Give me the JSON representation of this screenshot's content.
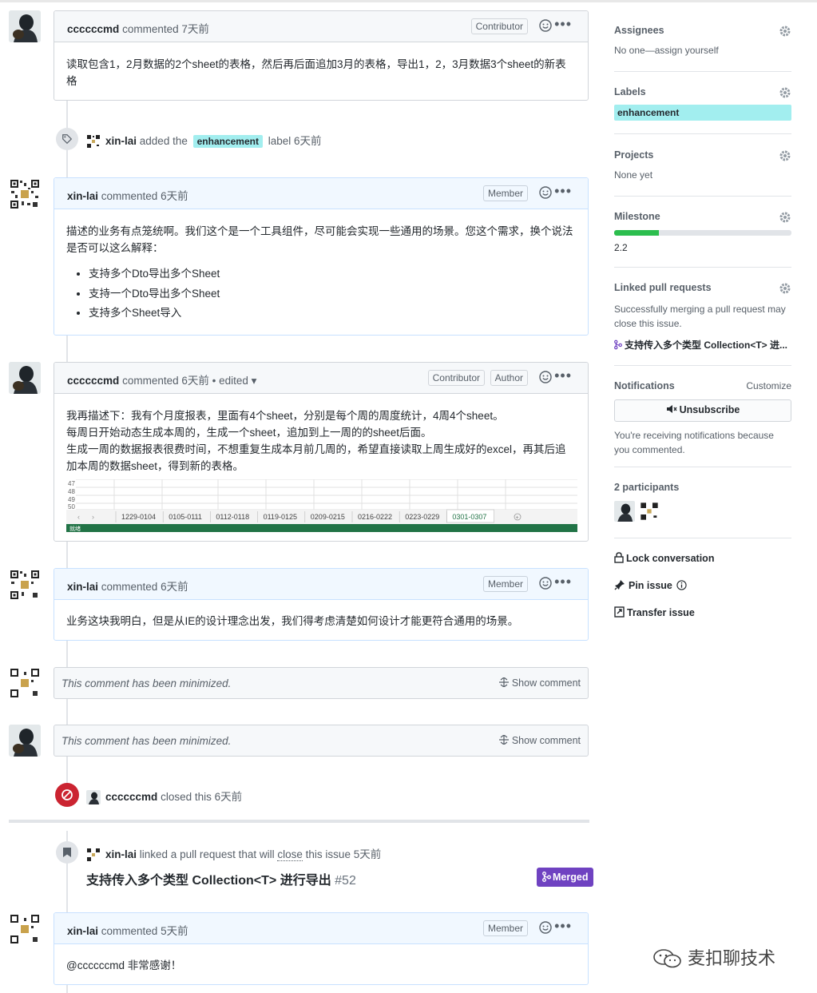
{
  "comments": [
    {
      "author": "ccccccmd",
      "action": "commented",
      "time": "7天前",
      "badges": [
        "Contributor"
      ],
      "body": "读取包含1，2月数据的2个sheet的表格，然后再后面追加3月的表格，导出1，2，3月数据3个sheet的新表格"
    },
    {
      "author": "xin-lai",
      "action": "commented",
      "time": "6天前",
      "badges": [
        "Member"
      ],
      "body": "描述的业务有点笼统啊。我们这个是一个工具组件，尽可能会实现一些通用的场景。您这个需求，换个说法是否可以这么解释：",
      "list": [
        "支持多个Dto导出多个Sheet",
        "支持一个Dto导出多个Sheet",
        "支持多个Sheet导入"
      ]
    },
    {
      "author": "ccccccmd",
      "action": "commented",
      "time": "6天前",
      "edited": "• edited ▾",
      "badges": [
        "Contributor",
        "Author"
      ],
      "lines": [
        "我再描述下：我有个月度报表，里面有4个sheet，分别是每个周的周度统计，4周4个sheet。",
        "每周日开始动态生成本周的，生成一个sheet，追加到上一周的的sheet后面。",
        "生成一周的数据报表很费时间，不想重复生成本月前几周的，希望直接读取上周生成好的excel，再其后追加本周的数据sheet，得到新的表格。"
      ],
      "sheet": {
        "rows": [
          "47",
          "48",
          "49",
          "50"
        ],
        "tabs": [
          "1229-0104",
          "0105-0111",
          "0112-0118",
          "0119-0125",
          "0209-0215",
          "0216-0222",
          "0223-0229",
          "0301-0307"
        ],
        "active_tab": "0301-0307",
        "status": "就绪"
      }
    },
    {
      "author": "xin-lai",
      "action": "commented",
      "time": "6天前",
      "badges": [
        "Member"
      ],
      "body": "业务这块我明白，但是从IE的设计理念出发，我们得考虑清楚如何设计才能更符合通用的场景。"
    },
    {
      "author": "xin-lai",
      "action": "commented",
      "time": "5天前",
      "badges": [
        "Member"
      ],
      "body": "@ccccccmd 非常感谢！"
    }
  ],
  "minimized": {
    "text": "This comment has been minimized.",
    "show": "Show comment"
  },
  "events": {
    "label": {
      "author": "xin-lai",
      "pre": "added the",
      "label": "enhancement",
      "post": "label",
      "time": "6天前"
    },
    "closed": {
      "author": "ccccccmd",
      "text": "closed this",
      "time": "6天前"
    },
    "linked": {
      "author": "xin-lai",
      "pre": "linked a pull request that will",
      "close": "close",
      "post": "this issue",
      "time": "5天前",
      "pr_title": "支持传入多个类型 Collection<T> 进行导出",
      "pr_number": "#52",
      "status": "Merged"
    }
  },
  "sidebar": {
    "assignees": {
      "title": "Assignees",
      "value": "No one—assign yourself"
    },
    "labels": {
      "title": "Labels",
      "value": "enhancement",
      "color": "#a2eeef"
    },
    "projects": {
      "title": "Projects",
      "value": "None yet"
    },
    "milestone": {
      "title": "Milestone",
      "value": "2.2",
      "progress": 0.25
    },
    "linked_prs": {
      "title": "Linked pull requests",
      "desc": "Successfully merging a pull request may close this issue.",
      "pr": "支持传入多个类型 Collection<T> 进..."
    },
    "notifications": {
      "title": "Notifications",
      "customize": "Customize",
      "button": "Unsubscribe",
      "desc": "You're receiving notifications because you commented."
    },
    "participants": {
      "title": "2 participants"
    },
    "actions": {
      "lock": "Lock conversation",
      "pin": "Pin issue",
      "transfer": "Transfer issue"
    }
  },
  "watermark": "麦扣聊技术",
  "colors": {
    "accent": "#6f42c1",
    "label": "#a2eeef",
    "closed": "#cb2431",
    "progress": "#2cbe4e"
  }
}
